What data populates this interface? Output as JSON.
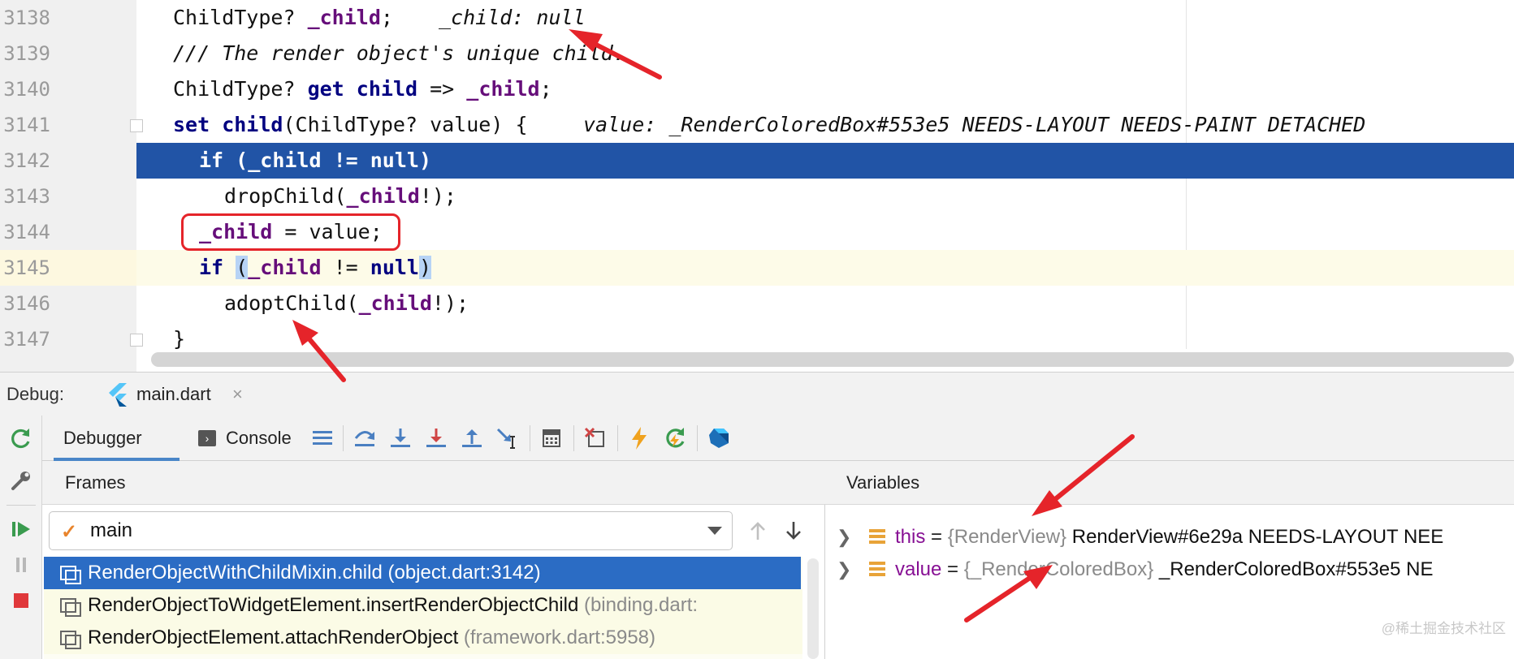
{
  "editor": {
    "lines": [
      {
        "num": "3138"
      },
      {
        "num": "3139"
      },
      {
        "num": "3140"
      },
      {
        "num": "3141"
      },
      {
        "num": "3142"
      },
      {
        "num": "3143"
      },
      {
        "num": "3144"
      },
      {
        "num": "3145"
      },
      {
        "num": "3146"
      },
      {
        "num": "3147"
      }
    ],
    "tokens": {
      "l3138_type": "ChildType? ",
      "l3138_field": "_child",
      "l3138_semi": ";",
      "l3138_inline": "_child: null",
      "l3139_comment": "/// The render object's unique child.",
      "l3140_type": "ChildType? ",
      "l3140_get": "get",
      "l3140_child": " child",
      "l3140_arrow": " => ",
      "l3140_field": "_child",
      "l3140_semi": ";",
      "l3141_set": "set",
      "l3141_child": " child",
      "l3141_params": "(ChildType? value) {",
      "l3141_inline": "value: _RenderColoredBox#553e5 NEEDS-LAYOUT NEEDS-PAINT DETACHED",
      "l3142_if": "if",
      "l3142_open": " (",
      "l3142_field": "_child",
      "l3142_rest": " != ",
      "l3142_null": "null",
      "l3142_close": ")",
      "l3143_call": "dropChild(",
      "l3143_field": "_child",
      "l3143_end": "!);",
      "l3144_field": "_child",
      "l3144_rest": " = value;",
      "l3145_if": "if",
      "l3145_sp": " ",
      "l3145_open": "(",
      "l3145_field": "_child",
      "l3145_rest": " != ",
      "l3145_null": "null",
      "l3145_close": ")",
      "l3146_call": "adoptChild(",
      "l3146_field": "_child",
      "l3146_end": "!);",
      "l3147_brace": "}"
    }
  },
  "debug": {
    "label": "Debug:",
    "run_tab": "main.dart",
    "close_glyph": "×",
    "tabs": {
      "debugger": "Debugger",
      "console": "Console"
    },
    "frames": {
      "title": "Frames",
      "thread": "main",
      "items": [
        {
          "name": "RenderObjectWithChildMixin.child",
          "location": " (object.dart:3142)"
        },
        {
          "name": "RenderObjectToWidgetElement.insertRenderObjectChild",
          "location": " (binding.dart:"
        },
        {
          "name": "RenderObjectElement.attachRenderObject",
          "location": " (framework.dart:5958)"
        }
      ]
    },
    "variables": {
      "title": "Variables",
      "items": [
        {
          "name": "this",
          "eq": " = ",
          "type": "{RenderView}",
          "value": " RenderView#6e29a NEEDS-LAYOUT NEE"
        },
        {
          "name": "value",
          "eq": " = ",
          "type": "{_RenderColoredBox}",
          "value": " _RenderColoredBox#553e5 NE"
        }
      ]
    }
  },
  "watermark": "@稀土掘金技术社区",
  "colors": {
    "exec_line": "#2154a6",
    "selected_frame": "#2b6cc4",
    "annotation_red": "#e5242a",
    "keyword": "#000080",
    "field": "#660e7a"
  }
}
